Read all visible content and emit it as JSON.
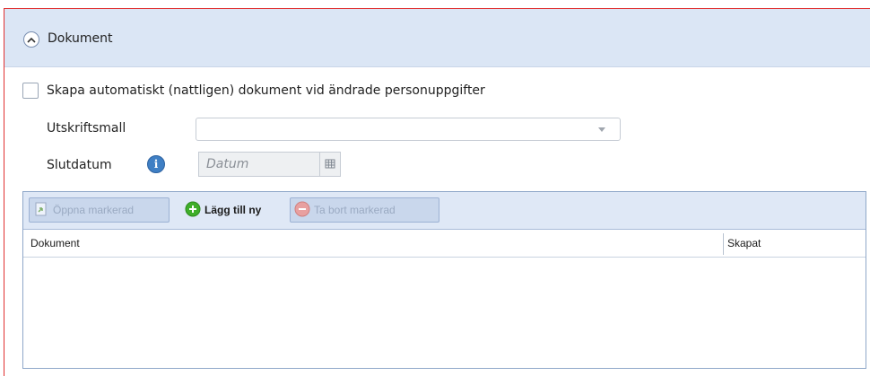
{
  "panel": {
    "title": "Dokument",
    "collapse_icon": "chevron-up-icon"
  },
  "auto_document": {
    "checked": false,
    "label": "Skapa automatiskt (nattligen) dokument vid ändrade personuppgifter"
  },
  "print_template": {
    "label": "Utskriftsmall",
    "value": ""
  },
  "end_date": {
    "label": "Slutdatum",
    "placeholder": "Datum",
    "info_icon": "info-icon",
    "calendar_icon": "calendar-icon"
  },
  "toolbar": {
    "open_label": "Öppna markerad",
    "add_label": "Lägg till ny",
    "remove_label": "Ta bort markerad"
  },
  "grid": {
    "columns": [
      "Dokument",
      "Skapat"
    ],
    "rows": []
  },
  "colors": {
    "header_bg": "#dbe6f5",
    "panel_border": "#e03030",
    "add_green": "#3fae2a",
    "remove_red": "#e06060"
  }
}
